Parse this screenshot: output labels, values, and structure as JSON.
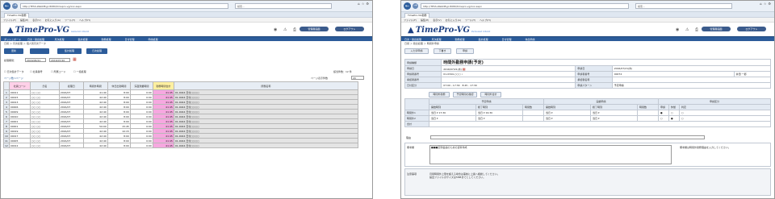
{
  "left": {
    "browser": {
      "url": "http://TESS-WebDB.jp:8080/timepro-vg/xxx.aspx",
      "search": "検索...",
      "tab": "TimePro-VG勤務"
    },
    "menus": [
      "ファイル(F)",
      "編集(E)",
      "表示(V)",
      "お気に入り(A)",
      "ツール(T)",
      "ヘルプ(H)"
    ],
    "logo": "TimePro-VG",
    "logo_sub": "General Client",
    "header_buttons": [
      "管理者画面",
      "ログアウト"
    ],
    "nav": [
      "ダッシュボード",
      "日次・勤怠処理",
      "月次処理",
      "集計処理",
      "勤務処理",
      "日付管理",
      "申請処理"
    ],
    "breadcrumb": "日報 ＞ 月次処理 ＞ 個人別月次データ",
    "toolbar": [
      "更新",
      "",
      "集計処理",
      "日次処理"
    ],
    "period_label": "処理期間：",
    "period_from": "2016/06/21",
    "period_to": "2016/07/20",
    "filter": {
      "check1": "日次集計データ",
      "check2": "社員番号",
      "check3": "所属コード",
      "check4": "一括処理",
      "count": "該当件数：12 件"
    },
    "pager": {
      "left": "ページ数 1ページ",
      "right": "ページ表示件数",
      "size": "20"
    },
    "columns": [
      "社員コード",
      "氏名",
      "処理日",
      "時間外時間",
      "休日出勤時間",
      "深夜残業時間",
      "勤務時間合計",
      "所属名称"
    ],
    "rows": [
      [
        "00011",
        "○○ ○○",
        "2016/07",
        "41:40",
        "8:00",
        "0:00",
        "41:45",
        "01-0044 日付○○○○"
      ],
      [
        "00015",
        "○○ ○○",
        "2016/07",
        "42:40",
        "8:00",
        "0:00",
        "41:45",
        "01-0044 日付○○○○"
      ],
      [
        "00013",
        "○○ ○○",
        "2016/07",
        "42:40",
        "8:00",
        "0:00",
        "41:45",
        "01-0044 日付○○○○"
      ],
      [
        "00006",
        "○○ ○○",
        "2016/07",
        "42:40",
        "8:00",
        "0:00",
        "41:45",
        "01-0044 日付○○○○"
      ],
      [
        "00009",
        "○○ ○○",
        "2016/07",
        "42:40",
        "8:00",
        "0:00",
        "41:45",
        "01-0044 日付○○○○"
      ],
      [
        "00010",
        "○○ ○○",
        "2016/07",
        "42:40",
        "8:00",
        "0:00",
        "41:45",
        "01-0044 日付○○○○"
      ],
      [
        "00001",
        "○○ ○○",
        "2016/07",
        "42:40",
        "8:00",
        "0:00",
        "41:45",
        "01-0044 日付○○○○"
      ],
      [
        "00001",
        "○○ ○○",
        "2016/07",
        "50:00",
        "15:45",
        "0:00",
        "41:45",
        "01-0044 日付○○○○"
      ],
      [
        "00019",
        "○○ ○○",
        "2016/07",
        "42:40",
        "10:15",
        "0:00",
        "41:45",
        "01-0044 日付○○○○"
      ],
      [
        "00017",
        "○○ ○○",
        "2016/07",
        "42:40",
        "8:00",
        "0:00",
        "41:45",
        "01-0044 日付○○○○"
      ],
      [
        "00005",
        "○○ ○○",
        "2016/07",
        "42:40",
        "8:00",
        "0:00",
        "41:45",
        "01-0044 日付○○○○"
      ],
      [
        "00012",
        "○○ ○○",
        "2016/07",
        "42:40",
        "8:00",
        "0:00",
        "41:45",
        "01-0044 日付○○○○"
      ]
    ]
  },
  "right": {
    "browser": {
      "url": "http://TESS-WebDB.jp:8080/timepro-vg/xxx.aspx",
      "search": "検索...",
      "tab": "TimePro-VG勤務"
    },
    "menus": [
      "ファイル(F)",
      "編集(E)",
      "表示(V)",
      "お気に入り(A)",
      "ツール(T)",
      "ヘルプ(H)"
    ],
    "logo": "TimePro-VG",
    "logo_sub": "Personal Client",
    "header_buttons": [
      "管理者画面",
      "ログアウト"
    ],
    "nav": [
      "日次・勤怠処理",
      "月次処理",
      "勤務処理",
      "集計処理",
      "日付管理",
      "休出申請"
    ],
    "breadcrumb": "日報 ＞ 勤怠処理 ＞ 時間外申請",
    "toolbar": [
      "入力済申請",
      "下書き",
      "申請"
    ],
    "form": {
      "type_label": "申請種類",
      "type_value": "時間外勤務申請(予定)",
      "date_label": "申請日",
      "date_value": "2016/07/21(木)",
      "apply_label": "申請日",
      "apply_value": "2016/07/21(木)",
      "no_label": "申請者番号",
      "no_value": "01-0344-○○○",
      "staff_label": "申請者番号",
      "staff_value": "00074",
      "name_value": "井田 一郎",
      "ver_label": "承認者番号",
      "ver2_label": "承認者名称",
      "shift_label": "日付区分",
      "shift_value": "07:00 - 17:30",
      "shift2": "8:45 - 17:30",
      "kind_label": "申請パターン",
      "kind_value": "予定申請"
    },
    "small_buttons": [
      "時間外勤務",
      "予定時間の確認",
      "時間外合計"
    ],
    "ot": {
      "head_plan": "予定申請",
      "head_act": "実績申請",
      "head_dept": "申請区分",
      "start": "開始時刻",
      "end": "終了時刻",
      "hours": "時間数",
      "flags": [
        "申請",
        "休憩",
        "判定"
      ],
      "row1": "時間外1",
      "row2": "時間外2",
      "total": "合計",
      "day": "当日",
      "t1": "17:30",
      "t2": "19:30"
    },
    "reason_label": "理由",
    "memo_label": "備考欄",
    "memo_text": "■■■定例会議のための資料作成",
    "memo_side": "備考欄は時間外勤務理由を入力してください。",
    "note_label": "注意事項",
    "note_text": "月間時間外上限を超える場合は事前に上長へ相談してください。\n提出ファイルのサイズは5MBまでとしてください。"
  }
}
